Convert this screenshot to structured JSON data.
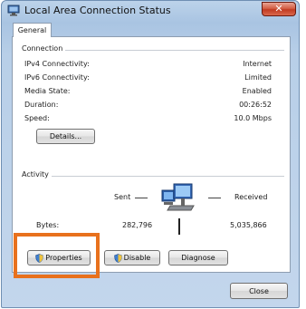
{
  "window": {
    "title": "Local Area Connection Status",
    "close_glyph": "✕"
  },
  "tabs": [
    {
      "label": "General",
      "active": true
    }
  ],
  "connection": {
    "group_label": "Connection",
    "rows": [
      {
        "label": "IPv4 Connectivity:",
        "value": "Internet"
      },
      {
        "label": "IPv6 Connectivity:",
        "value": "Limited"
      },
      {
        "label": "Media State:",
        "value": "Enabled"
      },
      {
        "label": "Duration:",
        "value": "00:26:52"
      },
      {
        "label": "Speed:",
        "value": "10.0 Mbps"
      }
    ],
    "details_button": "Details..."
  },
  "activity": {
    "group_label": "Activity",
    "sent_label": "Sent",
    "received_label": "Received",
    "bytes_label": "Bytes:",
    "bytes_sent": "282,796",
    "bytes_received": "5,035,866",
    "icon": "network-computers-icon"
  },
  "buttons": {
    "properties": "Properties",
    "disable": "Disable",
    "diagnose": "Diagnose",
    "close": "Close"
  },
  "colors": {
    "highlight": "#e8711d",
    "titlebar": "#b8cfe8",
    "close_button": "#c23b22"
  }
}
